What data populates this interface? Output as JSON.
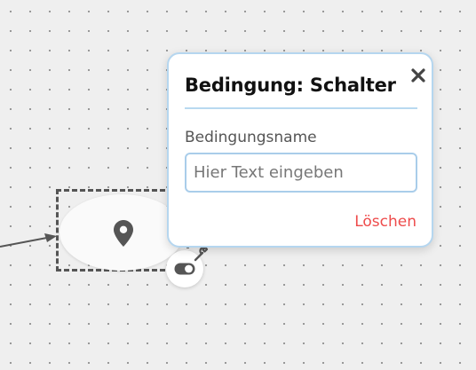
{
  "canvas": {
    "background_color": "#efefef",
    "dot_color": "#8c8c8c"
  },
  "node": {
    "icon": "map-marker-icon",
    "toggle_icon": "toggle-switch-icon",
    "settings_icon": "wrench-icon"
  },
  "dialog": {
    "title": "Bedingung: Schalter",
    "close_icon": "close-icon",
    "close_symbol": "✕",
    "name_label": "Bedingungsname",
    "name_value": "",
    "name_placeholder": "Hier Text eingeben",
    "delete_label": "Löschen",
    "border_color": "#b5d6ef",
    "delete_color": "#ee4b4b"
  }
}
